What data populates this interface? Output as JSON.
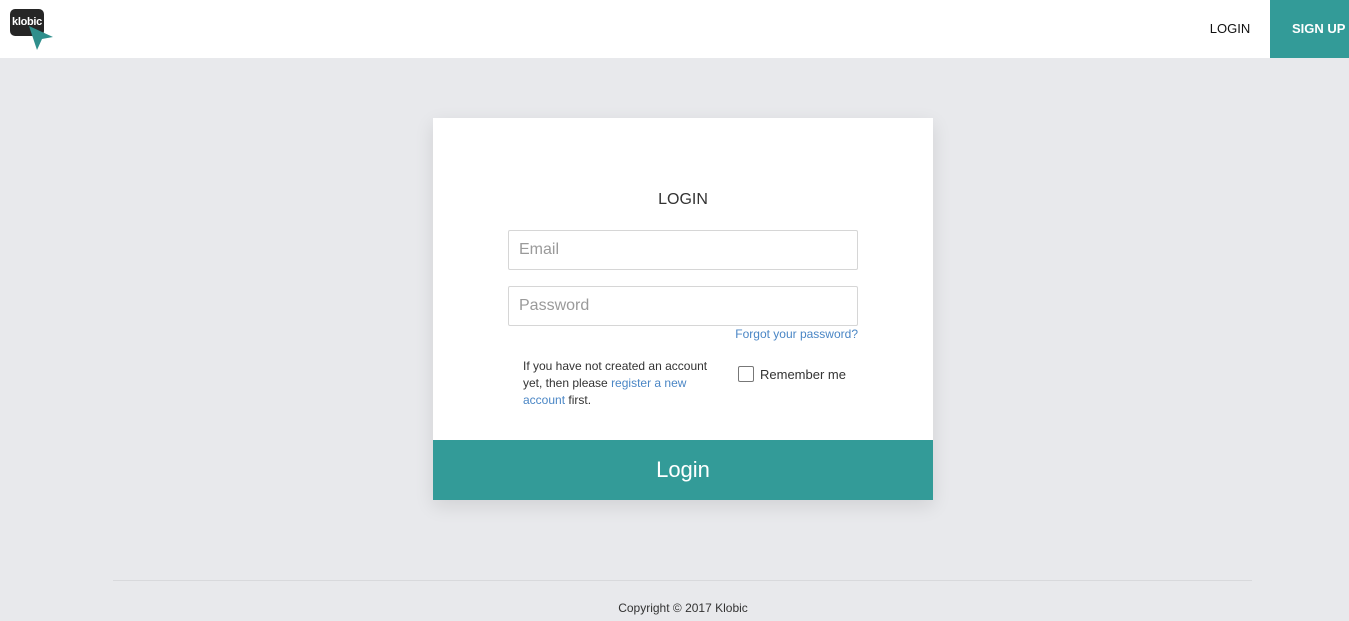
{
  "navbar": {
    "logo_text": "klobic",
    "login_label": "LOGIN",
    "signup_label": "SIGN UP",
    "accent_color": "#339b98"
  },
  "login_card": {
    "title": "LOGIN",
    "email_placeholder": "Email",
    "email_value": "",
    "password_placeholder": "Password",
    "password_value": "",
    "forgot_password": "Forgot your password?",
    "register_prefix": "If you have not created an account yet, then please ",
    "register_link": "register a new account",
    "register_suffix": " first.",
    "remember_me": "Remember me",
    "remember_checked": false,
    "login_button": "Login"
  },
  "footer": {
    "copyright": "Copyright © 2017 Klobic"
  },
  "icons": {
    "logo": "klobic-logo-icon",
    "checkbox": "checkbox-icon"
  }
}
